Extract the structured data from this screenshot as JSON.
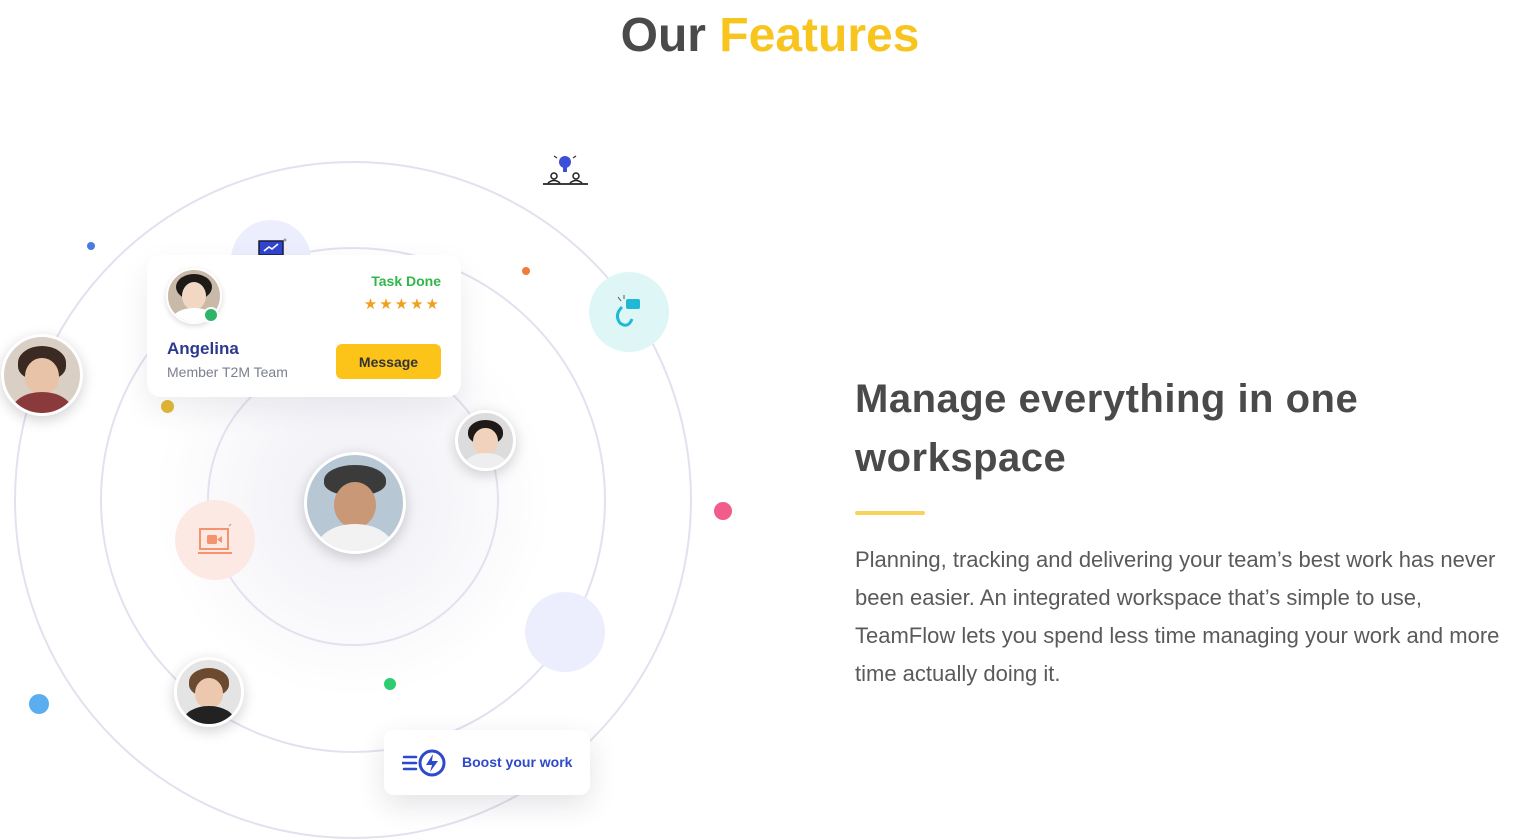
{
  "heading": {
    "prefix": "Our",
    "accent": "Features"
  },
  "profile_card": {
    "status": "Task Done",
    "rating_stars": "★★★★★",
    "name": "Angelina",
    "role": "Member T2M Team",
    "message_button": "Message"
  },
  "boost_card": {
    "label": "Boost your work"
  },
  "content": {
    "title": "Manage everything in one workspace",
    "description": "Planning, tracking and delivering your team’s best work has never been easier. An integrated workspace that’s simple to use, TeamFlow lets you spend less time managing your work and more time actually doing it."
  },
  "colors": {
    "accent": "#f7c51e",
    "heading": "#4a4a4a",
    "button": "#fcc419",
    "name_blue": "#2b3a8f",
    "success": "#2fb84a",
    "ring": "#e3e1ef"
  },
  "icons": [
    "lightbulb-icon",
    "presentation-icon",
    "chat-icon",
    "video-camera-icon",
    "lightning-icon",
    "star-icon"
  ]
}
